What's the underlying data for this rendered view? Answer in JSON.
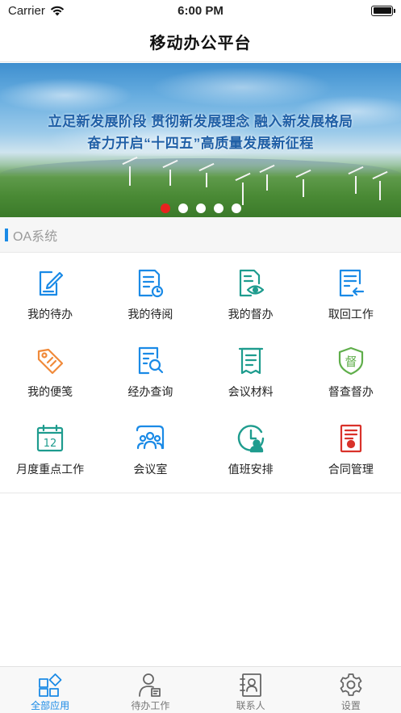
{
  "status_bar": {
    "carrier": "Carrier",
    "time": "6:00 PM"
  },
  "nav": {
    "title": "移动办公平台"
  },
  "banner": {
    "line1": "立足新发展阶段  贯彻新发展理念  融入新发展格局",
    "line2": "奋力开启“十四五”高质量发展新征程",
    "dots": 5,
    "active_dot": 0
  },
  "section": {
    "title": "OA系统"
  },
  "apps": [
    {
      "label": "我的待办",
      "icon": "edit-document-icon"
    },
    {
      "label": "我的待阅",
      "icon": "document-clock-icon"
    },
    {
      "label": "我的督办",
      "icon": "document-eye-icon"
    },
    {
      "label": "取回工作",
      "icon": "document-return-icon"
    },
    {
      "label": "我的便笺",
      "icon": "tag-icon"
    },
    {
      "label": "经办查询",
      "icon": "document-search-icon"
    },
    {
      "label": "会议材料",
      "icon": "scroll-icon"
    },
    {
      "label": "督查督办",
      "icon": "supervise-badge-icon"
    },
    {
      "label": "月度重点工作",
      "icon": "calendar-12-icon"
    },
    {
      "label": "会议室",
      "icon": "meeting-room-icon"
    },
    {
      "label": "值班安排",
      "icon": "duty-clock-icon"
    },
    {
      "label": "合同管理",
      "icon": "contract-icon"
    }
  ],
  "tabs": [
    {
      "label": "全部应用",
      "icon": "apps-grid-icon",
      "active": true
    },
    {
      "label": "待办工作",
      "icon": "user-task-icon",
      "active": false
    },
    {
      "label": "联系人",
      "icon": "contacts-icon",
      "active": false
    },
    {
      "label": "设置",
      "icon": "gear-icon",
      "active": false
    }
  ],
  "colors": {
    "accent": "#1a8ae6",
    "active_dot": "#e8231f",
    "icon_blue": "#1a8ae6",
    "icon_teal": "#1e9c8e",
    "icon_orange": "#f08a3a",
    "icon_green": "#5fae4a",
    "icon_red": "#d9322a"
  }
}
